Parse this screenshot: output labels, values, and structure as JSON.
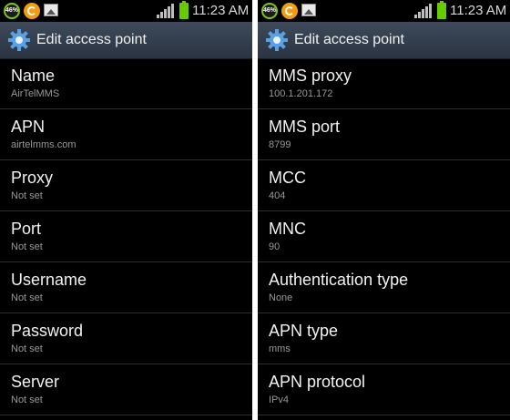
{
  "status_bar": {
    "battery_percent": "46%",
    "time": "11:23 AM",
    "icons": [
      "battery-percent-icon",
      "sync-icon",
      "gallery-icon",
      "signal-icon",
      "battery-icon"
    ]
  },
  "colors": {
    "background": "#000000",
    "title_bar": "#36414f",
    "battery_green": "#66cc00",
    "summary_text": "#9a9a9a"
  },
  "left_screen": {
    "title": "Edit access point",
    "items": [
      {
        "label": "Name",
        "value": "AirTelMMS"
      },
      {
        "label": "APN",
        "value": "airtelmms.com"
      },
      {
        "label": "Proxy",
        "value": "Not set"
      },
      {
        "label": "Port",
        "value": "Not set"
      },
      {
        "label": "Username",
        "value": "Not set"
      },
      {
        "label": "Password",
        "value": "Not set"
      },
      {
        "label": "Server",
        "value": "Not set"
      }
    ]
  },
  "right_screen": {
    "title": "Edit access point",
    "items": [
      {
        "label": "MMS proxy",
        "value": "100.1.201.172"
      },
      {
        "label": "MMS port",
        "value": "8799"
      },
      {
        "label": "MCC",
        "value": "404"
      },
      {
        "label": "MNC",
        "value": "90"
      },
      {
        "label": "Authentication type",
        "value": "None"
      },
      {
        "label": "APN type",
        "value": "mms"
      },
      {
        "label": "APN protocol",
        "value": "IPv4"
      }
    ]
  }
}
